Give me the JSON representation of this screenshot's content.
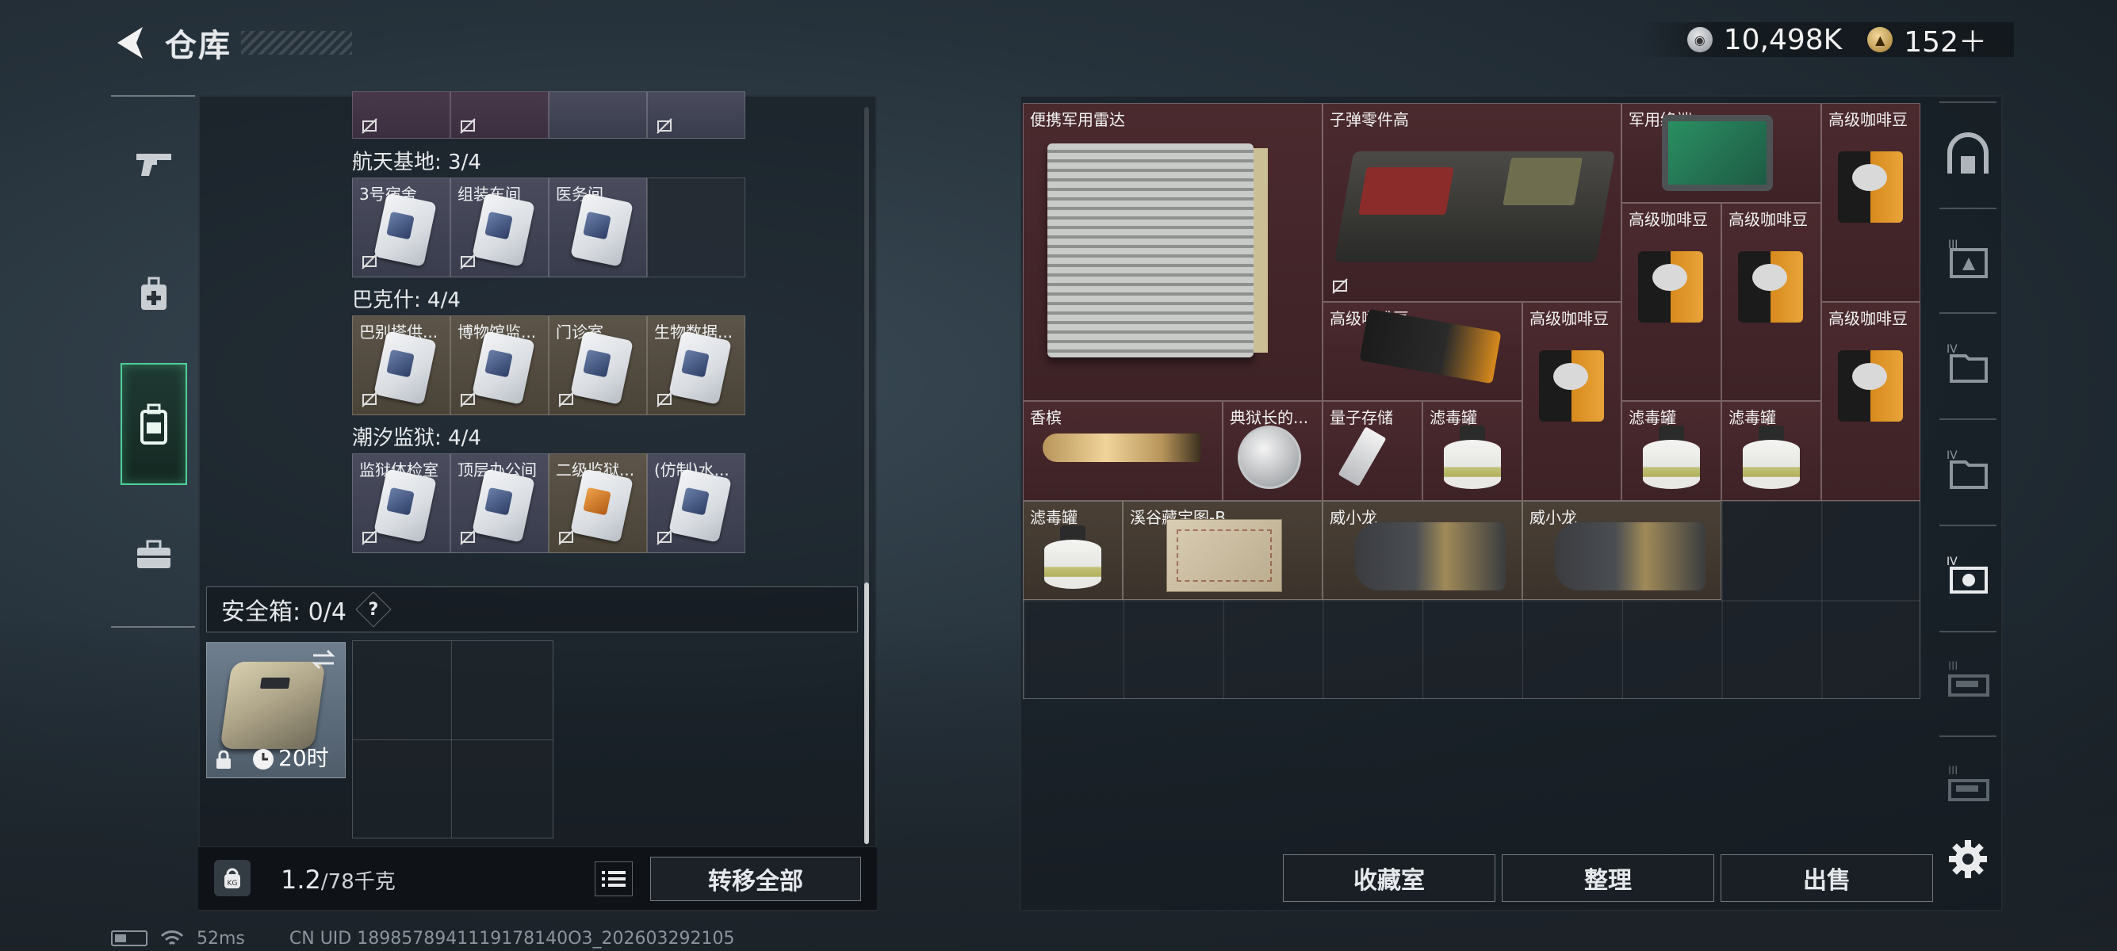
{
  "header": {
    "title": "仓库"
  },
  "currency": [
    {
      "icon": "silver-coin-icon",
      "value": "10,498K"
    },
    {
      "icon": "gold-coin-icon",
      "value": "152＋"
    }
  ],
  "left_tabs": [
    "pistol-icon",
    "medkit-icon",
    "backpack-icon",
    "toolbox-icon"
  ],
  "key_sections": [
    {
      "label": "航天基地: 3/4",
      "keys": [
        "3号宿舍",
        "组装车间",
        "医务间",
        ""
      ]
    },
    {
      "label": "巴克什: 4/4",
      "keys": [
        "巴别塔供...",
        "博物馆监...",
        "门诊室",
        "生物数据..."
      ]
    },
    {
      "label": "潮汐监狱: 4/4",
      "keys": [
        "监狱体检室",
        "顶层办公间",
        "二级监狱...",
        "(仿制)水..."
      ]
    }
  ],
  "safebox": {
    "label": "安全箱: 0/4",
    "help": "?",
    "time": "20时"
  },
  "weight": {
    "value": "1.2",
    "max": "/78千克",
    "icon_text": "KG"
  },
  "transfer_all": "转移全部",
  "items": {
    "radar": "便携军用雷达",
    "ammo_parts": "子弹零件高",
    "terminal": "军用终端",
    "coffee": "高级咖啡豆",
    "champagne": "香槟",
    "warden_medal": "典狱长的...",
    "quantum": "量子存储",
    "filter": "滤毒罐",
    "map": "溪谷藏宝图-B",
    "glove": "威小龙"
  },
  "actions": {
    "collection": "收藏室",
    "sort": "整理",
    "sell": "出售"
  },
  "status": {
    "ping": "52ms",
    "uid": "CN UID 1898578941119178140O3_202603292105"
  }
}
